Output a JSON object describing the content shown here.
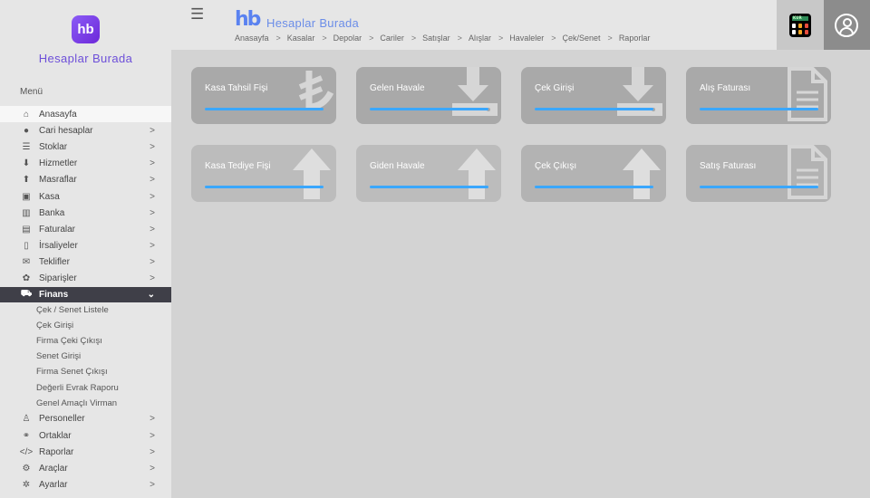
{
  "brand": {
    "name": "Hesaplar Burada",
    "logo_text": "hb"
  },
  "sidebar": {
    "heading": "Menü",
    "items": [
      {
        "label": "Anasayfa",
        "icon": "home-icon",
        "chevron": ""
      },
      {
        "label": "Cari hesaplar",
        "icon": "user-circle-icon",
        "chevron": ">"
      },
      {
        "label": "Stoklar",
        "icon": "list-icon",
        "chevron": ">"
      },
      {
        "label": "Hizmetler",
        "icon": "download-icon",
        "chevron": ">"
      },
      {
        "label": "Masraflar",
        "icon": "upload-icon",
        "chevron": ">"
      },
      {
        "label": "Kasa",
        "icon": "money-icon",
        "chevron": ">"
      },
      {
        "label": "Banka",
        "icon": "bank-icon",
        "chevron": ">"
      },
      {
        "label": "Faturalar",
        "icon": "invoice-icon",
        "chevron": ">"
      },
      {
        "label": "İrsaliyeler",
        "icon": "document-icon",
        "chevron": ">"
      },
      {
        "label": "Teklifler",
        "icon": "envelope-icon",
        "chevron": ">"
      },
      {
        "label": "Siparişler",
        "icon": "gift-icon",
        "chevron": ">"
      }
    ],
    "expanded": {
      "label": "Finans",
      "icon": "cart-icon",
      "chevron": "⌄"
    },
    "subitems": [
      "Çek / Senet Listele",
      "Çek Girişi",
      "Firma Çeki Çıkışı",
      "Senet Girişi",
      "Firma Senet Çıkışı",
      "Değerli Evrak Raporu",
      "Genel Amaçlı Virman"
    ],
    "items_after": [
      {
        "label": "Personeller",
        "icon": "person-icon",
        "chevron": ">"
      },
      {
        "label": "Ortaklar",
        "icon": "handshake-icon",
        "chevron": ">"
      },
      {
        "label": "Raporlar",
        "icon": "code-icon",
        "chevron": ">"
      },
      {
        "label": "Araçlar",
        "icon": "gear-icon",
        "chevron": ">"
      },
      {
        "label": "Ayarlar",
        "icon": "cog-icon",
        "chevron": ">"
      }
    ]
  },
  "topbar": {
    "title": "Hesaplar Burada",
    "logo_text": "hb",
    "breadcrumbs": [
      "Anasayfa",
      "Kasalar",
      "Depolar",
      "Cariler",
      "Satışlar",
      "Alışlar",
      "Havaleler",
      "Çek/Senet",
      "Raporlar"
    ],
    "calc_label": "KUR"
  },
  "tiles": [
    {
      "label": "Kasa Tahsil Fişi",
      "icon": "lira-icon",
      "shade": "dark"
    },
    {
      "label": "Gelen Havale",
      "icon": "download-tray-icon",
      "shade": "dark"
    },
    {
      "label": "Çek Girişi",
      "icon": "download-tray-icon",
      "shade": "dark"
    },
    {
      "label": "Alış Faturası",
      "icon": "document-icon",
      "shade": "dark"
    },
    {
      "label": "Kasa Tediye Fişi",
      "icon": "arrow-up-icon",
      "shade": "light"
    },
    {
      "label": "Giden Havale",
      "icon": "arrow-up-icon",
      "shade": "light"
    },
    {
      "label": "Çek Çıkışı",
      "icon": "arrow-up-icon",
      "shade": "dark"
    },
    {
      "label": "Satış Faturası",
      "icon": "document-icon",
      "shade": "dark"
    }
  ],
  "colors": {
    "accent_bar": "#3aa7ff",
    "finans_bg": "#3f3f48",
    "brand_purple": "#7c4dff"
  }
}
